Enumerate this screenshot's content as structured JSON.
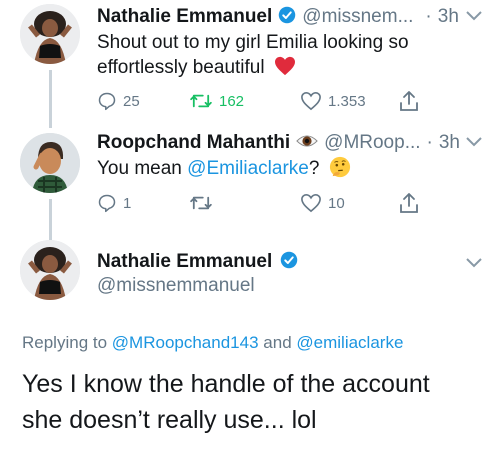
{
  "tweets": [
    {
      "name": "Nathalie Emmanuel",
      "handle": "@missnem...",
      "dot": "·",
      "time": "3h",
      "text": "Shout out to my girl Emilia looking so effortlessly beautiful",
      "reply_count": "25",
      "retweet_count": "162",
      "like_count": "1.353"
    },
    {
      "name": "Roopchand Mahanthi",
      "handle": "@MRoop...",
      "dot": "·",
      "time": "3h",
      "text_before": "You mean ",
      "mention": "@Emiliaclarke",
      "text_after": "?",
      "reply_count": "1",
      "retweet_count": "",
      "like_count": "10"
    }
  ],
  "main_tweet": {
    "name": "Nathalie Emmanuel",
    "handle": "@missnemmanuel",
    "replying_prefix": "Replying to",
    "replying_user1": "@MRoopchand143",
    "replying_and": "and",
    "replying_user2": "@emiliaclarke",
    "text": "Yes I know the handle of the account she doesn’t really use... lol"
  },
  "colors": {
    "accent": "#1b95e0",
    "retweet": "#17bf63",
    "heart": "#e0245e",
    "muted": "#657786",
    "thread": "#c9d2d9"
  }
}
